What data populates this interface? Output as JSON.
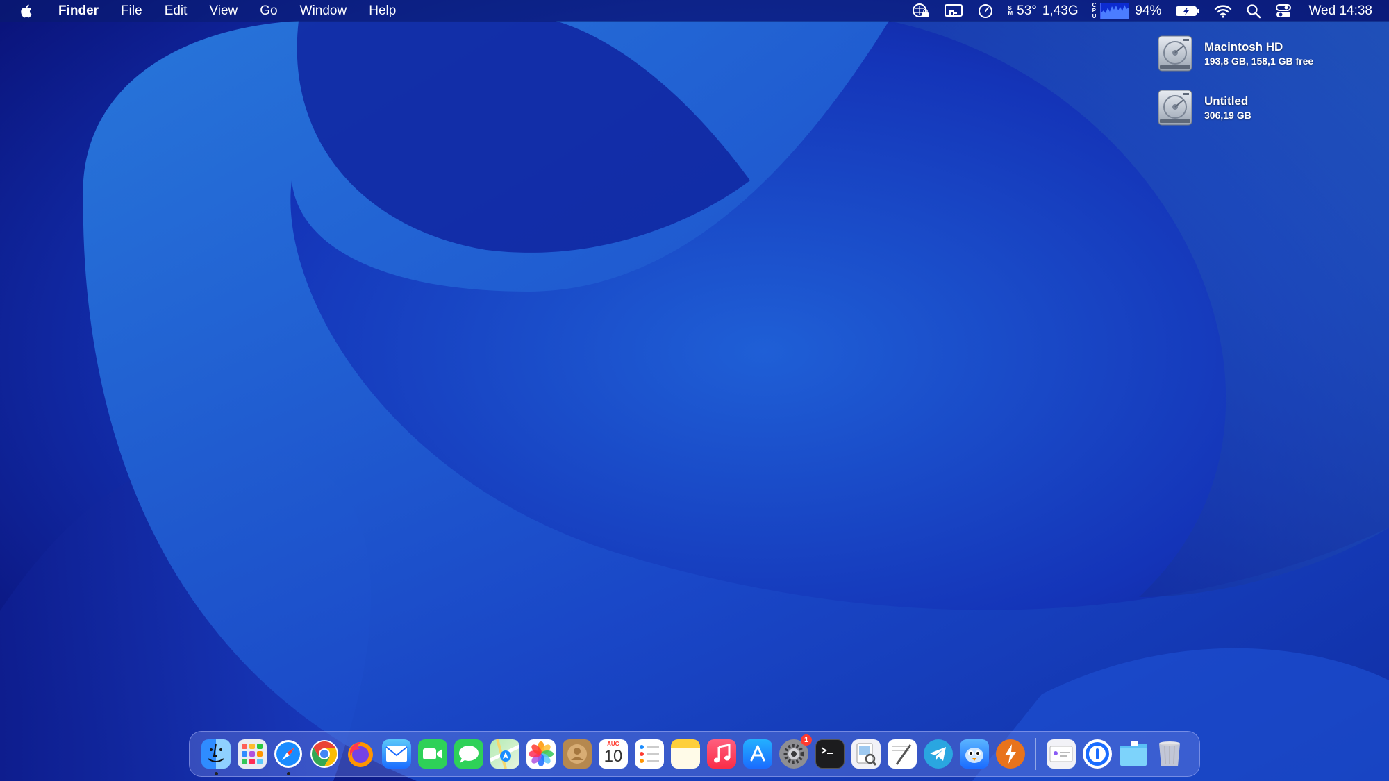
{
  "menubar": {
    "app_name": "Finder",
    "menus": [
      "File",
      "Edit",
      "View",
      "Go",
      "Window",
      "Help"
    ],
    "status": {
      "temp_text": "53°",
      "memory_text": "1,43G",
      "cpu_percent_text": "94%",
      "clock": "Wed 14:38"
    }
  },
  "desktop": {
    "drives": [
      {
        "name": "Macintosh HD",
        "info": "193,8 GB, 158,1 GB free"
      },
      {
        "name": "Untitled",
        "info": "306,19 GB"
      }
    ]
  },
  "dock": {
    "calendar": {
      "month": "AUG",
      "day": "10"
    },
    "settings_badge": "1",
    "apps": [
      {
        "name": "Finder",
        "running": true
      },
      {
        "name": "Launchpad",
        "running": false
      },
      {
        "name": "Safari",
        "running": true
      },
      {
        "name": "Chrome",
        "running": false
      },
      {
        "name": "Firefox",
        "running": false
      },
      {
        "name": "Mail",
        "running": false
      },
      {
        "name": "FaceTime",
        "running": false
      },
      {
        "name": "Messages",
        "running": false
      },
      {
        "name": "Maps",
        "running": false
      },
      {
        "name": "Photos",
        "running": false
      },
      {
        "name": "Contacts",
        "running": false
      },
      {
        "name": "Calendar",
        "running": false
      },
      {
        "name": "Reminders",
        "running": false
      },
      {
        "name": "Notes",
        "running": false
      },
      {
        "name": "Music",
        "running": false
      },
      {
        "name": "App Store",
        "running": false
      },
      {
        "name": "System Settings",
        "running": false
      },
      {
        "name": "Terminal",
        "running": false
      },
      {
        "name": "Preview",
        "running": false
      },
      {
        "name": "TextEdit",
        "running": false
      },
      {
        "name": "Telegram",
        "running": false
      },
      {
        "name": "Tweetbot",
        "running": false
      },
      {
        "name": "Reeder",
        "running": false
      },
      {
        "name": "Mail Folder",
        "running": false
      },
      {
        "name": "1Password",
        "running": false
      },
      {
        "name": "Downloads",
        "running": false
      },
      {
        "name": "Trash",
        "running": false
      }
    ]
  },
  "colors": {
    "wallpaper_dark": "#0a1577",
    "wallpaper_mid": "#1b3fd0",
    "wallpaper_light": "#2a73d8"
  }
}
